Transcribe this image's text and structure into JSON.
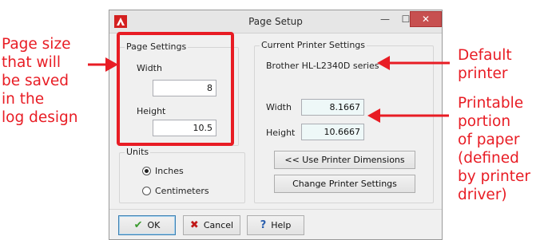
{
  "annotations": {
    "left": [
      "Page size",
      "that will",
      "be saved",
      "in the",
      "log design"
    ],
    "right_top": [
      "Default",
      "printer"
    ],
    "right_bottom": [
      "Printable",
      "portion",
      "of paper",
      "(defined",
      "by printer",
      "driver)"
    ]
  },
  "window": {
    "title": "Page Setup",
    "minimize": "—",
    "maximize": "☐",
    "close": "✕"
  },
  "page_settings": {
    "title": "Page Settings",
    "width_label": "Width",
    "width_value": "8",
    "height_label": "Height",
    "height_value": "10.5"
  },
  "printer_settings": {
    "title": "Current Printer Settings",
    "printer_name": "Brother HL-L2340D series",
    "width_label": "Width",
    "width_value": "8.1667",
    "height_label": "Height",
    "height_value": "10.6667",
    "use_dims_button": "<< Use Printer Dimensions",
    "change_button": "Change Printer Settings"
  },
  "units": {
    "title": "Units",
    "options": [
      "Inches",
      "Centimeters"
    ],
    "selected": "Inches"
  },
  "buttons": {
    "ok": "OK",
    "cancel": "Cancel",
    "help": "Help"
  },
  "colors": {
    "annotation": "#e81c24",
    "ok_check": "#3a9a2e",
    "cancel_x": "#c01818",
    "help_q": "#2b5fae"
  }
}
